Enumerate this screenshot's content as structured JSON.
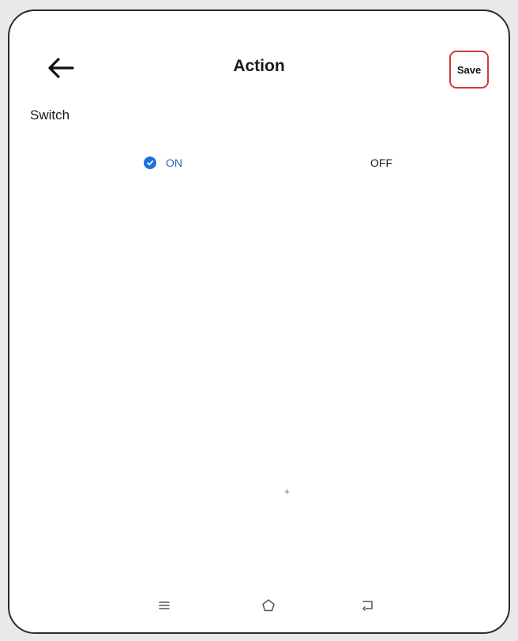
{
  "header": {
    "title": "Action",
    "save_label": "Save",
    "accent_color": "#d23a3a"
  },
  "switch_section": {
    "label": "Switch",
    "options": [
      {
        "label": "ON",
        "selected": true
      },
      {
        "label": "OFF",
        "selected": false
      }
    ],
    "selected_color": "#1e6fe0"
  },
  "nav_bar": {
    "icons": [
      "menu-icon",
      "home-icon",
      "back-icon"
    ]
  }
}
